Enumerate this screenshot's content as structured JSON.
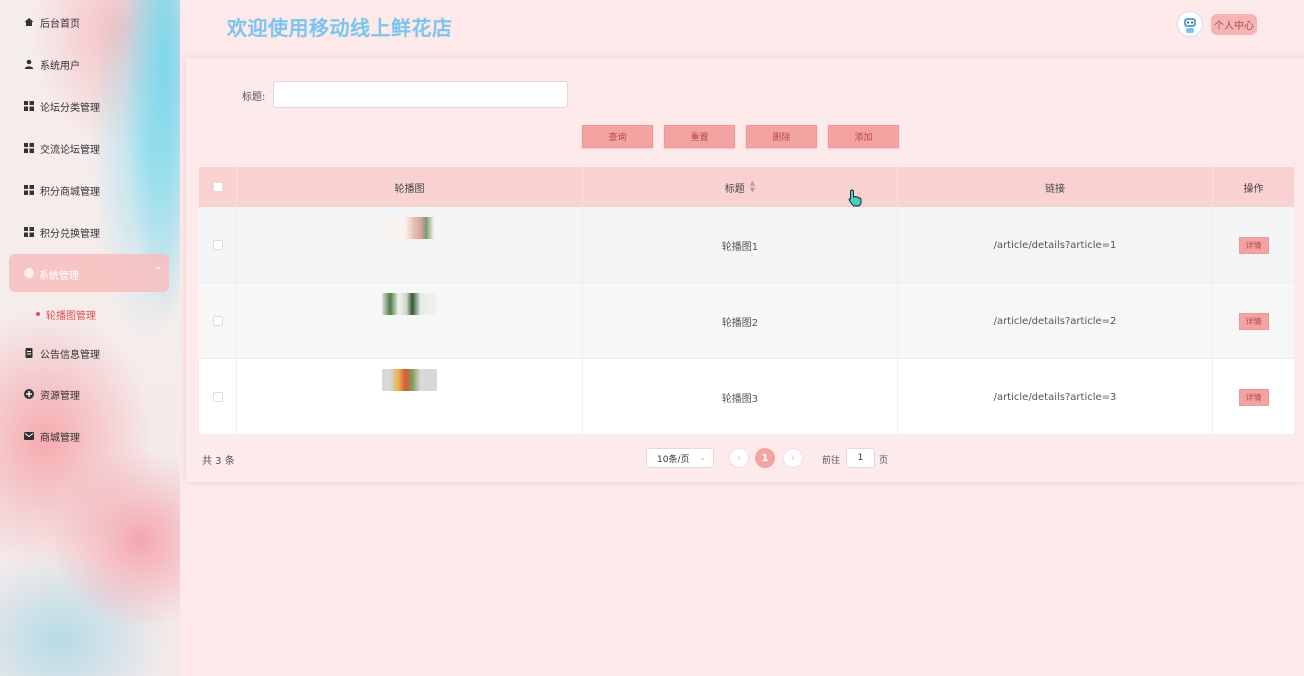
{
  "header": {
    "title": "欢迎使用移动线上鲜花店",
    "user_center": "个人中心"
  },
  "sidebar": {
    "items": [
      {
        "label": "后台首页",
        "icon": "home-icon"
      },
      {
        "label": "系统用户",
        "icon": "user-icon"
      },
      {
        "label": "论坛分类管理",
        "icon": "grid-icon"
      },
      {
        "label": "交流论坛管理",
        "icon": "grid-icon"
      },
      {
        "label": "积分商城管理",
        "icon": "grid-icon"
      },
      {
        "label": "积分兑换管理",
        "icon": "grid-icon"
      },
      {
        "label": "系统管理",
        "icon": "settings-icon",
        "expanded": true
      },
      {
        "label": "公告信息管理",
        "icon": "document-icon"
      },
      {
        "label": "资源管理",
        "icon": "plus-circle-icon"
      },
      {
        "label": "商城管理",
        "icon": "mail-icon"
      }
    ],
    "sub_items": [
      {
        "label": "轮播图管理",
        "active": true
      }
    ]
  },
  "search": {
    "label": "标题:",
    "value": "",
    "placeholder": ""
  },
  "actions": {
    "query": "查询",
    "reset": "重置",
    "delete": "删除",
    "add": "添加"
  },
  "table": {
    "columns": [
      "轮播图",
      "标题",
      "链接",
      "操作"
    ],
    "rows": [
      {
        "title": "轮播图1",
        "link": "/article/details?article=1",
        "action": "详情"
      },
      {
        "title": "轮播图2",
        "link": "/article/details?article=2",
        "action": "详情"
      },
      {
        "title": "轮播图3",
        "link": "/article/details?article=3",
        "action": "详情"
      }
    ]
  },
  "pagination": {
    "total": "共 3 条",
    "page_size": "10条/页",
    "current_page": "1",
    "goto_label": "前往",
    "goto_value": "1",
    "goto_suffix": "页"
  },
  "colors": {
    "accent": "#f4a3a3",
    "title_blue": "#7ac5ef",
    "header_row": "#f9d1d1",
    "background": "#fde9e9"
  }
}
